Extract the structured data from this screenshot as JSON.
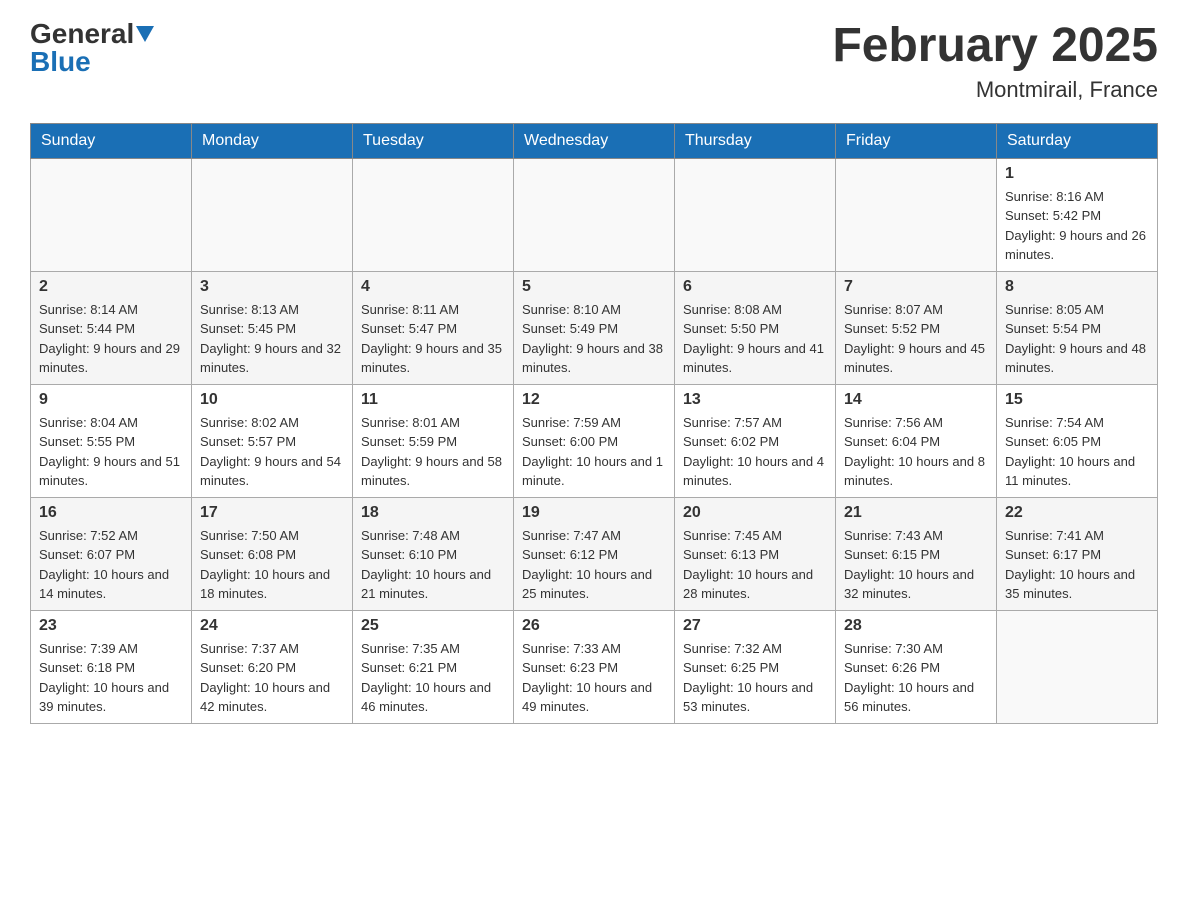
{
  "header": {
    "logo_general": "General",
    "logo_blue": "Blue",
    "month_title": "February 2025",
    "location": "Montmirail, France"
  },
  "weekdays": [
    "Sunday",
    "Monday",
    "Tuesday",
    "Wednesday",
    "Thursday",
    "Friday",
    "Saturday"
  ],
  "weeks": [
    [
      {
        "day": "",
        "info": ""
      },
      {
        "day": "",
        "info": ""
      },
      {
        "day": "",
        "info": ""
      },
      {
        "day": "",
        "info": ""
      },
      {
        "day": "",
        "info": ""
      },
      {
        "day": "",
        "info": ""
      },
      {
        "day": "1",
        "info": "Sunrise: 8:16 AM\nSunset: 5:42 PM\nDaylight: 9 hours and 26 minutes."
      }
    ],
    [
      {
        "day": "2",
        "info": "Sunrise: 8:14 AM\nSunset: 5:44 PM\nDaylight: 9 hours and 29 minutes."
      },
      {
        "day": "3",
        "info": "Sunrise: 8:13 AM\nSunset: 5:45 PM\nDaylight: 9 hours and 32 minutes."
      },
      {
        "day": "4",
        "info": "Sunrise: 8:11 AM\nSunset: 5:47 PM\nDaylight: 9 hours and 35 minutes."
      },
      {
        "day": "5",
        "info": "Sunrise: 8:10 AM\nSunset: 5:49 PM\nDaylight: 9 hours and 38 minutes."
      },
      {
        "day": "6",
        "info": "Sunrise: 8:08 AM\nSunset: 5:50 PM\nDaylight: 9 hours and 41 minutes."
      },
      {
        "day": "7",
        "info": "Sunrise: 8:07 AM\nSunset: 5:52 PM\nDaylight: 9 hours and 45 minutes."
      },
      {
        "day": "8",
        "info": "Sunrise: 8:05 AM\nSunset: 5:54 PM\nDaylight: 9 hours and 48 minutes."
      }
    ],
    [
      {
        "day": "9",
        "info": "Sunrise: 8:04 AM\nSunset: 5:55 PM\nDaylight: 9 hours and 51 minutes."
      },
      {
        "day": "10",
        "info": "Sunrise: 8:02 AM\nSunset: 5:57 PM\nDaylight: 9 hours and 54 minutes."
      },
      {
        "day": "11",
        "info": "Sunrise: 8:01 AM\nSunset: 5:59 PM\nDaylight: 9 hours and 58 minutes."
      },
      {
        "day": "12",
        "info": "Sunrise: 7:59 AM\nSunset: 6:00 PM\nDaylight: 10 hours and 1 minute."
      },
      {
        "day": "13",
        "info": "Sunrise: 7:57 AM\nSunset: 6:02 PM\nDaylight: 10 hours and 4 minutes."
      },
      {
        "day": "14",
        "info": "Sunrise: 7:56 AM\nSunset: 6:04 PM\nDaylight: 10 hours and 8 minutes."
      },
      {
        "day": "15",
        "info": "Sunrise: 7:54 AM\nSunset: 6:05 PM\nDaylight: 10 hours and 11 minutes."
      }
    ],
    [
      {
        "day": "16",
        "info": "Sunrise: 7:52 AM\nSunset: 6:07 PM\nDaylight: 10 hours and 14 minutes."
      },
      {
        "day": "17",
        "info": "Sunrise: 7:50 AM\nSunset: 6:08 PM\nDaylight: 10 hours and 18 minutes."
      },
      {
        "day": "18",
        "info": "Sunrise: 7:48 AM\nSunset: 6:10 PM\nDaylight: 10 hours and 21 minutes."
      },
      {
        "day": "19",
        "info": "Sunrise: 7:47 AM\nSunset: 6:12 PM\nDaylight: 10 hours and 25 minutes."
      },
      {
        "day": "20",
        "info": "Sunrise: 7:45 AM\nSunset: 6:13 PM\nDaylight: 10 hours and 28 minutes."
      },
      {
        "day": "21",
        "info": "Sunrise: 7:43 AM\nSunset: 6:15 PM\nDaylight: 10 hours and 32 minutes."
      },
      {
        "day": "22",
        "info": "Sunrise: 7:41 AM\nSunset: 6:17 PM\nDaylight: 10 hours and 35 minutes."
      }
    ],
    [
      {
        "day": "23",
        "info": "Sunrise: 7:39 AM\nSunset: 6:18 PM\nDaylight: 10 hours and 39 minutes."
      },
      {
        "day": "24",
        "info": "Sunrise: 7:37 AM\nSunset: 6:20 PM\nDaylight: 10 hours and 42 minutes."
      },
      {
        "day": "25",
        "info": "Sunrise: 7:35 AM\nSunset: 6:21 PM\nDaylight: 10 hours and 46 minutes."
      },
      {
        "day": "26",
        "info": "Sunrise: 7:33 AM\nSunset: 6:23 PM\nDaylight: 10 hours and 49 minutes."
      },
      {
        "day": "27",
        "info": "Sunrise: 7:32 AM\nSunset: 6:25 PM\nDaylight: 10 hours and 53 minutes."
      },
      {
        "day": "28",
        "info": "Sunrise: 7:30 AM\nSunset: 6:26 PM\nDaylight: 10 hours and 56 minutes."
      },
      {
        "day": "",
        "info": ""
      }
    ]
  ]
}
